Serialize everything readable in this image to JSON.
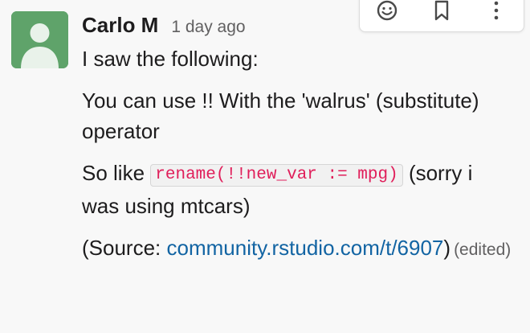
{
  "message": {
    "author": "Carlo M",
    "timestamp": "1 day ago",
    "paragraphs": {
      "p1": "I saw the following:",
      "p2": "You can use !! With the 'walrus' (substitute) operator",
      "p3_before": "So like ",
      "p3_code": "rename(!!new_var := mpg)",
      "p3_after": " (sorry i was using mtcars)",
      "p4_before": "(Source: ",
      "p4_link": "community.rstudio.com/t/6907",
      "p4_after": ")",
      "edited": "(edited)"
    }
  },
  "toolbar": {
    "icons": [
      "emoji-reaction-icon",
      "bookmark-icon",
      "more-actions-icon"
    ]
  },
  "colors": {
    "avatar_bg": "#5fa36a",
    "link": "#1264a3",
    "code_text": "#e01e5a"
  }
}
